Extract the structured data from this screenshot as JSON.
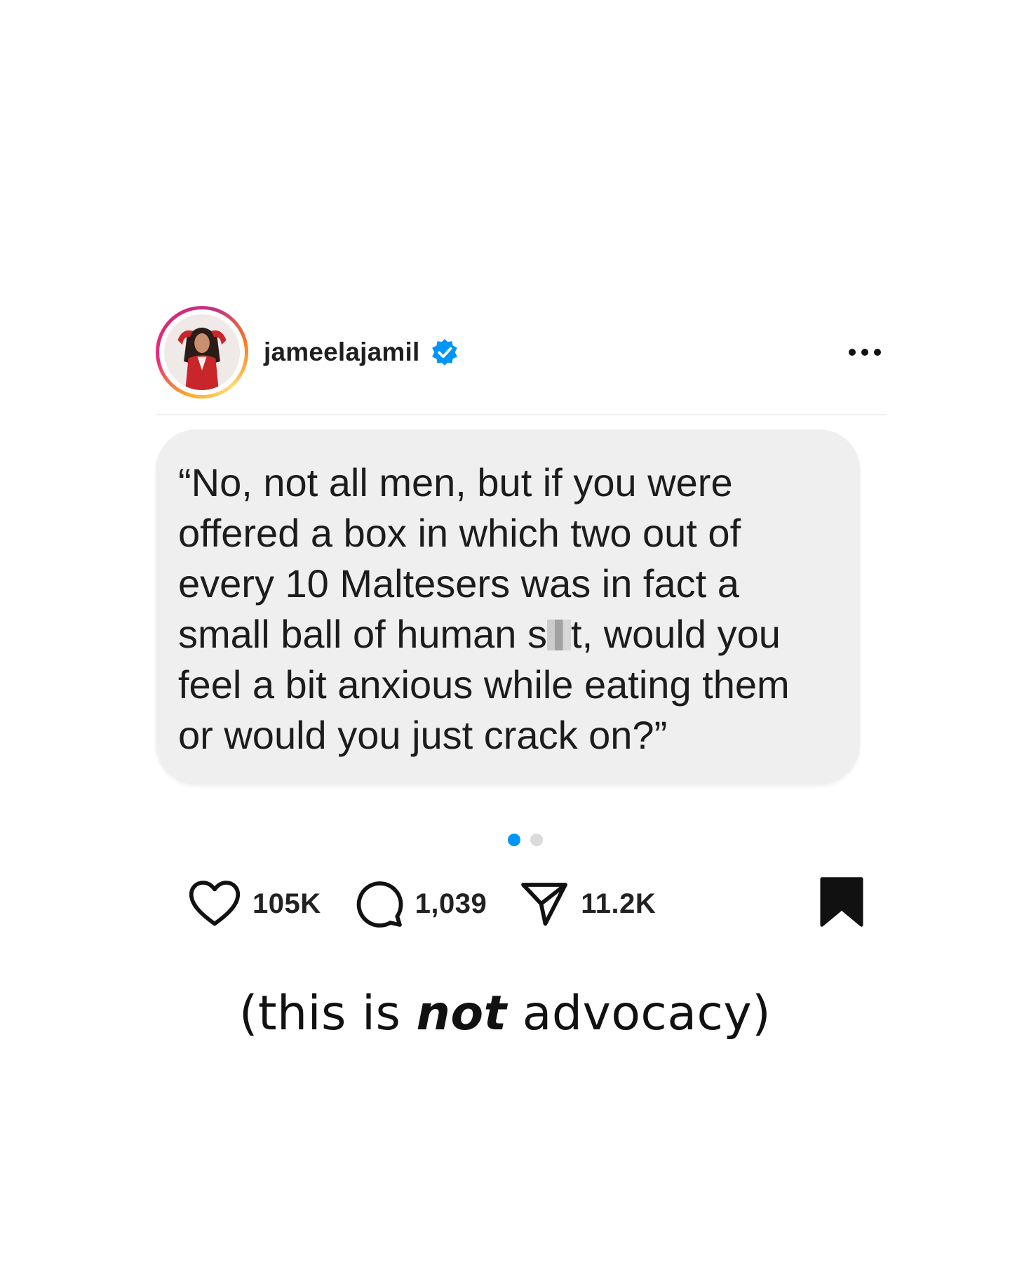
{
  "post": {
    "username": "jameelajamil",
    "verified": true,
    "avatar_icon": "profile-photo",
    "more_icon": "more-horizontal-icon"
  },
  "quote": {
    "before_censor": "“No, not all men, but if you were\noffered a box in which two out of\nevery 10 Maltesers was in fact a\nsmall ball of human s",
    "after_censor": "t, would you\nfeel a bit anxious while eating them\nor would you just crack on?”"
  },
  "carousel": {
    "total": 2,
    "active_index": 0
  },
  "actions": {
    "likes": "105K",
    "comments": "1,039",
    "shares": "11.2K",
    "like_icon": "heart-icon",
    "comment_icon": "comment-icon",
    "share_icon": "send-icon",
    "save_icon": "bookmark-icon"
  },
  "caption": {
    "before": "(this is ",
    "emphasis": "not",
    "after": " advocacy)"
  },
  "colors": {
    "accent_blue": "#0095f6",
    "bubble_bg": "#efefef",
    "ring_gradient": [
      "#feda75",
      "#fa7e1e",
      "#d62976",
      "#962fbf"
    ]
  }
}
